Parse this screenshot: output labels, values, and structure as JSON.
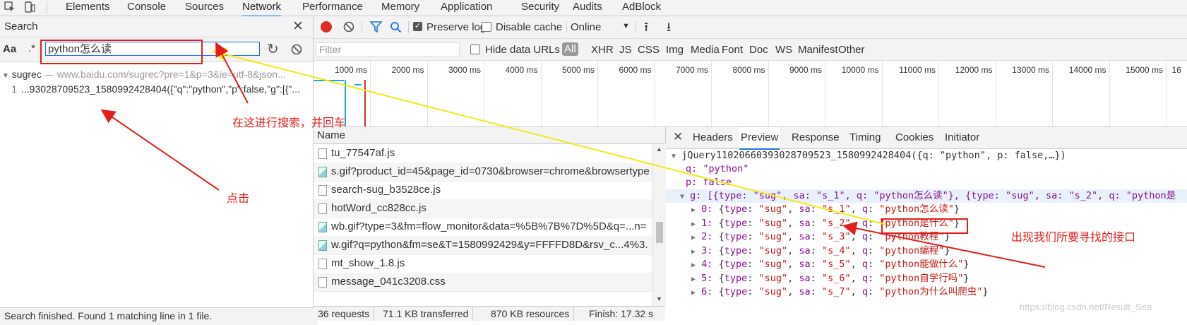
{
  "topbar": {
    "tabs": [
      "Elements",
      "Console",
      "Sources",
      "Network",
      "Performance",
      "Memory",
      "Application",
      "Security",
      "Audits",
      "AdBlock"
    ],
    "active": "Network"
  },
  "search": {
    "title": "Search",
    "query": "python怎么读",
    "case_label": "Aa",
    "regex_label": ".*",
    "result_file": "sugrec",
    "result_url": "— www.baidu.com/sugrec?pre=1&p=3&ie=utf-8&json...",
    "result_line_no": "1",
    "result_line": "...93028709523_1580992428404({\"q\":\"python\",\"p\":false,\"g\":[{\"...",
    "status": "Search finished.  Found 1 matching line in 1 file."
  },
  "network_toolbar": {
    "preserve_log": "Preserve log",
    "preserve_checked": true,
    "disable_cache": "Disable cache",
    "disable_checked": false,
    "throttle": "Online"
  },
  "filter": {
    "placeholder": "Filter",
    "hide_data_urls": "Hide data URLs",
    "types": [
      "All",
      "XHR",
      "JS",
      "CSS",
      "Img",
      "Media",
      "Font",
      "Doc",
      "WS",
      "Manifest",
      "Other"
    ]
  },
  "timeline": {
    "ticks": [
      "1000 ms",
      "2000 ms",
      "3000 ms",
      "4000 ms",
      "5000 ms",
      "6000 ms",
      "7000 ms",
      "8000 ms",
      "9000 ms",
      "10000 ms",
      "11000 ms",
      "12000 ms",
      "13000 ms",
      "14000 ms",
      "15000 ms",
      "16"
    ]
  },
  "requests": {
    "header": "Name",
    "rows": [
      {
        "name": "tu_77547af.js",
        "kind": "doc"
      },
      {
        "name": "s.gif?product_id=45&page_id=0730&browser=chrome&browsertype",
        "kind": "img"
      },
      {
        "name": "search-sug_b3528ce.js",
        "kind": "doc"
      },
      {
        "name": "hotWord_cc828cc.js",
        "kind": "doc"
      },
      {
        "name": "wb.gif?type=3&fm=flow_monitor&data=%5B%7B%7D%5D&q=...n=",
        "kind": "img"
      },
      {
        "name": "w.gif?q=python&fm=se&T=1580992429&y=FFFFD8D&rsv_c...4%3.",
        "kind": "img"
      },
      {
        "name": "mt_show_1.8.js",
        "kind": "doc"
      },
      {
        "name": "message_041c3208.css",
        "kind": "doc"
      }
    ]
  },
  "statusbar": {
    "requests": "36 requests",
    "transferred": "71.1 KB transferred",
    "resources": "870 KB resources",
    "finish": "Finish: 17.32 s"
  },
  "preview": {
    "tabs": [
      "Headers",
      "Preview",
      "Response",
      "Timing",
      "Cookies",
      "Initiator"
    ],
    "active": "Preview",
    "root": "jQuery110206603930​28709523_1580992428404({q: \"python\", p: false,…})",
    "q_line": "q: \"python\"",
    "p_line": "p: false",
    "g_line": "g: [{type: \"sug\", sa: \"s_1\", q: \"python怎么读\"}, {type: \"sug\", sa: \"s_2\", q: \"python是",
    "items": [
      {
        "idx": "0:",
        "sa": "s_1",
        "q": "python怎么读"
      },
      {
        "idx": "1:",
        "sa": "s_2",
        "q": "python是什么"
      },
      {
        "idx": "2:",
        "sa": "s_3",
        "q": "python教程"
      },
      {
        "idx": "3:",
        "sa": "s_4",
        "q": "python编程"
      },
      {
        "idx": "4:",
        "sa": "s_5",
        "q": "python能做什么"
      },
      {
        "idx": "5:",
        "sa": "s_6",
        "q": "python自学行吗"
      },
      {
        "idx": "6:",
        "sa": "s_7",
        "q": "python为什么叫爬虫"
      }
    ]
  },
  "annotations": {
    "search_here": "在这进行搜索，并回车",
    "click": "点击",
    "found": "出现我们所要寻找的接口"
  },
  "watermark": "https://blog.csdn.net/Result_Sea"
}
